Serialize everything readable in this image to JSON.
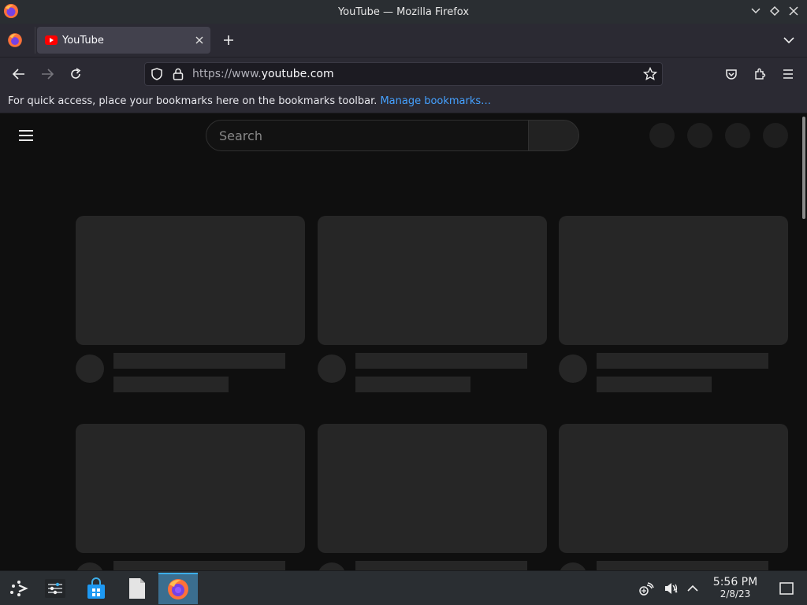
{
  "window": {
    "title": "YouTube — Mozilla Firefox"
  },
  "tabs": [
    {
      "label": "YouTube",
      "favicon": "youtube-icon",
      "active": true
    }
  ],
  "navbar": {
    "url_prefix": "https://www.",
    "url_domain": "youtube.com"
  },
  "bookmarks_bar": {
    "message": "For quick access, place your bookmarks here on the bookmarks toolbar.",
    "link": "Manage bookmarks…"
  },
  "youtube": {
    "search_placeholder": "Search",
    "skeleton_cards": 6,
    "header_action_placeholders": 4
  },
  "taskbar": {
    "apps": [
      "app-launcher-icon",
      "system-settings-icon",
      "discover-store-icon",
      "file-icon",
      "firefox-icon"
    ],
    "active_app": "firefox-icon",
    "tray": [
      "network-icon",
      "volume-muted-icon",
      "tray-expand-icon"
    ],
    "time": "5:56 PM",
    "date": "2/8/23"
  },
  "colors": {
    "accent": "#3daee9",
    "link": "#45a1ff",
    "youtube_red": "#ff0000"
  }
}
